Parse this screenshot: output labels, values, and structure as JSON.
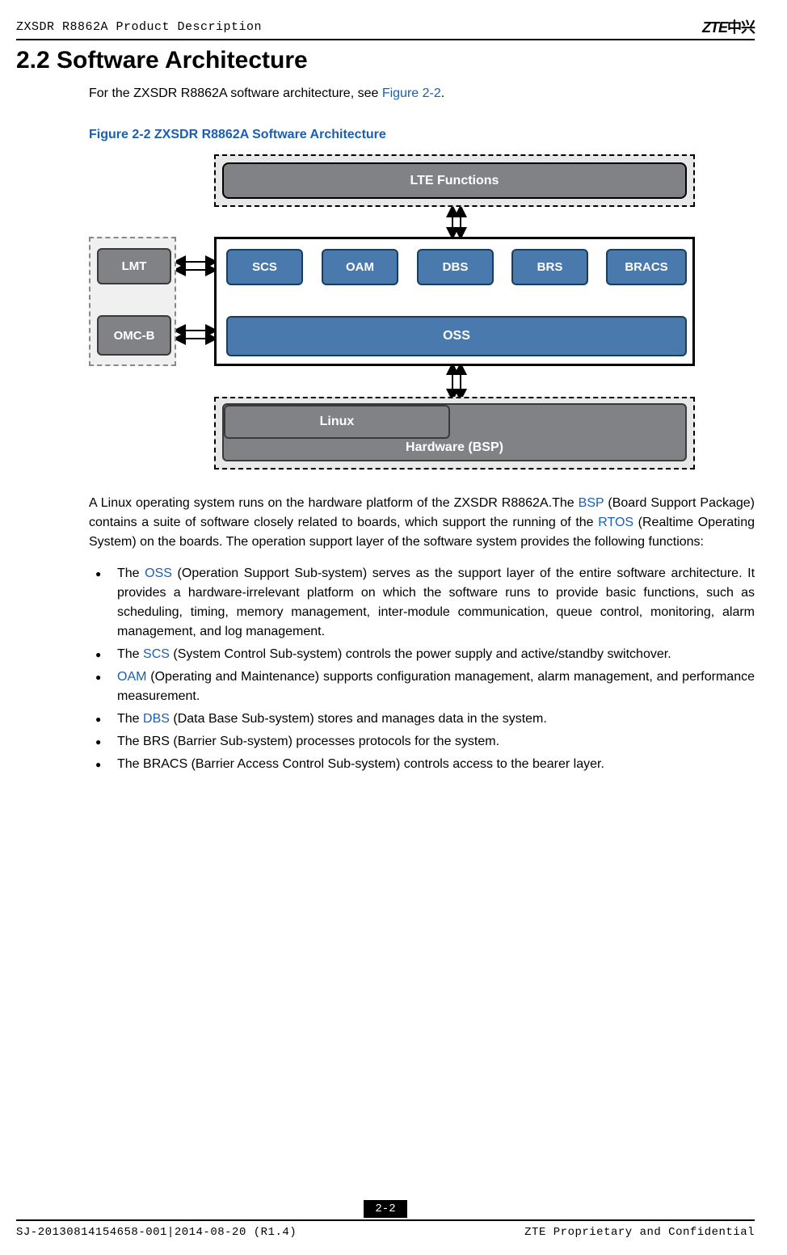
{
  "header": {
    "doc_title": "ZXSDR R8862A Product Description",
    "logo_text": "ZTE",
    "logo_cn": "中兴"
  },
  "section": {
    "heading": "2.2 Software Architecture",
    "intro_pre": "For the ZXSDR R8862A software architecture, see ",
    "intro_link": "Figure 2-2",
    "intro_post": "."
  },
  "figure": {
    "caption": "Figure 2-2 ZXSDR R8862A Software Architecture",
    "labels": {
      "lte": "LTE Functions",
      "lmt": "LMT",
      "omcb": "OMC-B",
      "scs": "SCS",
      "oam": "OAM",
      "dbs": "DBS",
      "brs": "BRS",
      "bracs": "BRACS",
      "oss": "OSS",
      "linux": "Linux",
      "hardware": "Hardware (BSP)"
    }
  },
  "paragraph": {
    "p1_a": "A Linux operating system runs on the hardware platform of the ZXSDR R8862A.The ",
    "p1_link1": "BSP",
    "p1_b": " (Board Support Package) contains a suite of software closely related to boards, which support the running of the ",
    "p1_link2": "RTOS",
    "p1_c": " (Realtime Operating System) on the boards. The operation support layer of the software system provides the following functions:"
  },
  "bullets": {
    "b1_a": "The ",
    "b1_link": "OSS",
    "b1_b": " (Operation Support Sub-system) serves as the support layer of the entire software architecture. It provides a hardware-irrelevant platform on which the software runs to provide basic functions, such as scheduling, timing, memory management, inter-module communication, queue control, monitoring, alarm management, and log management.",
    "b2_a": "The ",
    "b2_link": "SCS",
    "b2_b": " (System Control Sub-system) controls the power supply and active/standby switchover.",
    "b3_link": "OAM",
    "b3_b": " (Operating and Maintenance) supports configuration management, alarm management, and performance measurement.",
    "b4_a": "The ",
    "b4_link": "DBS",
    "b4_b": " (Data Base Sub-system) stores and manages data in the system.",
    "b5": "The BRS (Barrier Sub-system) processes protocols for the system.",
    "b6": "The BRACS (Barrier Access Control Sub-system) controls access to the bearer layer."
  },
  "footer": {
    "page_num": "2-2",
    "left": "SJ-20130814154658-001|2014-08-20 (R1.4)",
    "right": "ZTE Proprietary and Confidential"
  }
}
